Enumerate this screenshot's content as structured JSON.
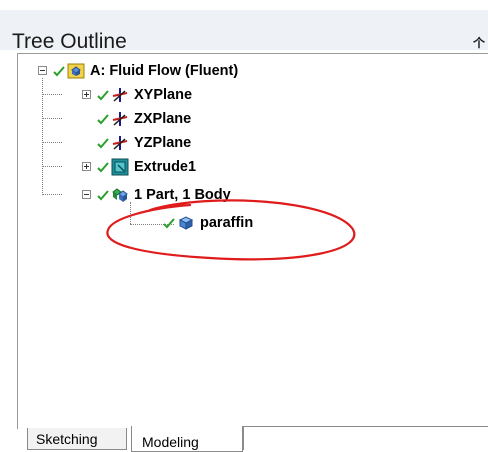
{
  "panel": {
    "title": "Tree Outline",
    "pin_glyph": "⩷"
  },
  "tree": {
    "root": {
      "label": "A: Fluid Flow (Fluent)",
      "icon": "project-icon"
    },
    "items": [
      {
        "label": "XYPlane",
        "icon": "plane-axes-icon"
      },
      {
        "label": "ZXPlane",
        "icon": "plane-axes-icon"
      },
      {
        "label": "YZPlane",
        "icon": "plane-axes-icon"
      },
      {
        "label": "Extrude1",
        "icon": "extrude-icon"
      },
      {
        "label": "1 Part, 1 Body",
        "icon": "parts-icon"
      },
      {
        "label": "paraffin",
        "icon": "body-icon"
      }
    ]
  },
  "tabs": [
    {
      "label": "Sketching",
      "active": false
    },
    {
      "label": "Modeling",
      "active": true
    }
  ],
  "colors": {
    "check": "#2aa02a",
    "annotation": "#e01b1b",
    "title_bar": "#eef2f7"
  }
}
